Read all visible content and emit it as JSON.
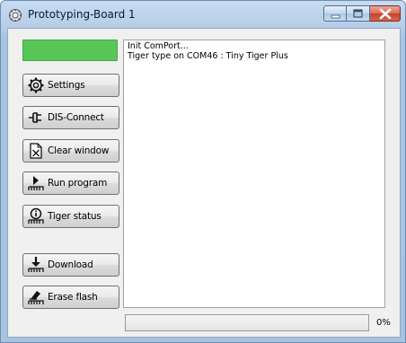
{
  "window": {
    "title": "Prototyping-Board 1"
  },
  "colors": {
    "status_ok": "#58c758",
    "titlebar": "#b6cde6",
    "close_button": "#c7412b"
  },
  "buttons": {
    "settings": "Settings",
    "dis_connect": "DIS-Connect",
    "clear_window": "Clear window",
    "run_program": "Run program",
    "tiger_status": "Tiger status",
    "download": "Download",
    "erase_flash": "Erase flash"
  },
  "icons": {
    "settings": "gear-icon",
    "dis_connect": "plug-icon",
    "clear_window": "clear-icon",
    "run_program": "run-icon",
    "tiger_status": "info-icon",
    "download": "download-icon",
    "erase_flash": "eraser-icon"
  },
  "log": {
    "lines": [
      "Init ComPort...",
      "Tiger type on COM46 : Tiny Tiger Plus"
    ]
  },
  "progress": {
    "value": 0,
    "label": "0%"
  }
}
